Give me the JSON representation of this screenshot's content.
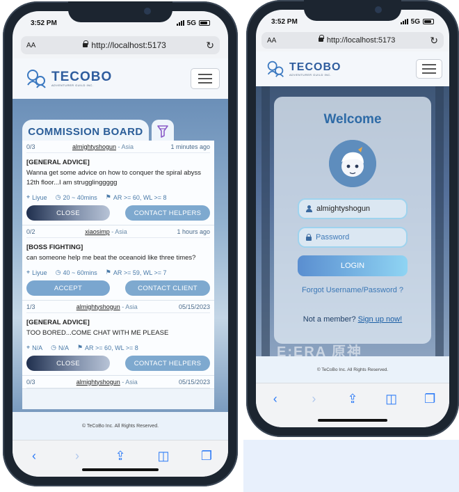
{
  "left_phone": {
    "status": {
      "time": "3:52 PM",
      "network": "5G"
    },
    "browser": {
      "text_size": "AA",
      "url": "http://localhost:5173"
    },
    "logo": {
      "name": "TECOBO",
      "tagline": "ADVENTURER GUILD INC."
    },
    "board": {
      "title": "COMMISSION BOARD",
      "commissions": [
        {
          "count": "0/3",
          "user": "almightyshogun",
          "region": " - Asia",
          "time": "1 minutes ago",
          "category": "[GENERAL ADVICE]",
          "description": "Wanna get some advice on how to conquer the spiral abyss 12th floor...I am strugglinggggg",
          "location": "Liyue",
          "duration": "20 ~ 40mins",
          "requirement": "AR >= 60, WL >= 8",
          "primary_button": "CLOSE",
          "secondary_button": "CONTACT HELPERS"
        },
        {
          "count": "0/2",
          "user": "xiaosimp",
          "region": " - Asia",
          "time": "1 hours ago",
          "category": "[BOSS FIGHTING]",
          "description": "can someone help me beat the oceanoid like three times?",
          "location": "Liyue",
          "duration": "40 ~ 60mins",
          "requirement": "AR >= 59, WL >= 7",
          "primary_button": "ACCEPT",
          "secondary_button": "CONTACT CLIENT"
        },
        {
          "count": "1/3",
          "user": "almightyshogun",
          "region": " - Asia",
          "time": "05/15/2023",
          "category": "[GENERAL ADVICE]",
          "description": "TOO BORED...COME CHAT WITH ME PLEASE",
          "location": "N/A",
          "duration": "N/A",
          "requirement": "AR >= 60, WL >= 8",
          "primary_button": "CLOSE",
          "secondary_button": "CONTACT HELPERS"
        },
        {
          "count": "0/3",
          "user": "almightyshogun",
          "region": " - Asia",
          "time": "05/15/2023"
        }
      ]
    },
    "footer": {
      "copyright": "© TeCoBo Inc. All Rights Reserved."
    }
  },
  "right_phone": {
    "status": {
      "time": "3:52 PM",
      "network": "5G"
    },
    "browser": {
      "text_size": "AA",
      "url": "http://localhost:5173"
    },
    "logo": {
      "name": "TECOBO",
      "tagline": "ADVENTURER GUILD INC."
    },
    "login": {
      "heading": "Welcome",
      "username_value": "almightyshogun",
      "password_placeholder": "Password",
      "login_button": "LOGIN",
      "forgot_link": "Forgot Username/Password ?",
      "member_prompt": "Not a member?",
      "signup_link": "Sign up now!",
      "watermark": "E:ERA  原神"
    },
    "footer": {
      "copyright": "© TeCoBo Inc. All Rights Reserved."
    }
  },
  "colors": {
    "brand_blue": "#2f5d9e",
    "button_light": "#7ea9cf",
    "safari_blue": "#2f7cf6"
  },
  "icons": [
    "lock-icon",
    "reload-icon",
    "menu-icon",
    "filter-icon",
    "location-pin-icon",
    "clock-icon",
    "badge-icon",
    "user-icon",
    "back-icon",
    "forward-icon",
    "share-icon",
    "bookmarks-icon",
    "tabs-icon"
  ]
}
